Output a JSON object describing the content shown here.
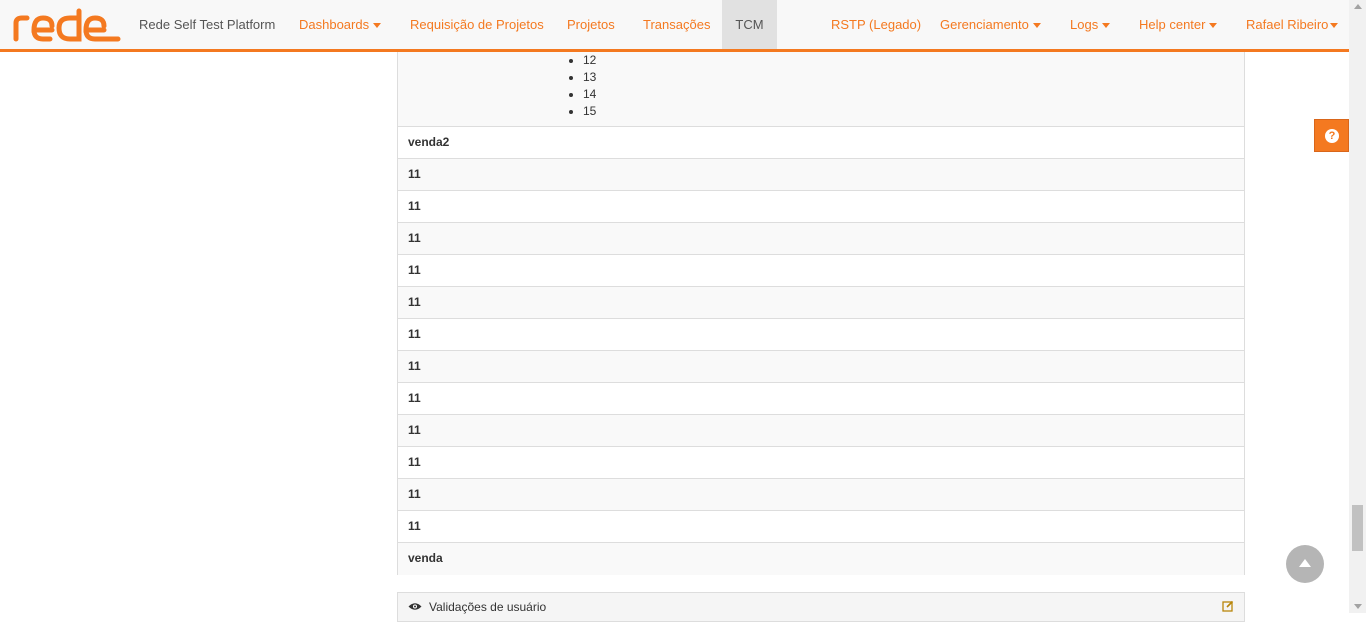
{
  "brand": {
    "logo_text": "rede",
    "name": "Rede Self Test Platform"
  },
  "nav": {
    "dashboards": "Dashboards",
    "requisicao": "Requisição de Projetos",
    "projetos": "Projetos",
    "transacoes": "Transações",
    "tcm": "TCM",
    "rstp": "RSTP (Legado)",
    "gerenciamento": "Gerenciamento",
    "logs": "Logs",
    "help_center": "Help center",
    "user": "Rafael Ribeiro"
  },
  "list_items": [
    "12",
    "13",
    "14",
    "15"
  ],
  "rows": {
    "r0": "venda2",
    "r1": "11",
    "r2": "11",
    "r3": "11",
    "r4": "11",
    "r5": "11",
    "r6": "11",
    "r7": "11",
    "r8": "11",
    "r9": "11",
    "r10": "11",
    "r11": "11",
    "r12": "11",
    "r13": "venda"
  },
  "validations": {
    "title": "Validações de usuário"
  },
  "help": {
    "label": "?"
  },
  "colors": {
    "accent": "#f47920",
    "stripe": "#f9f9f9",
    "border": "#dddddd"
  }
}
